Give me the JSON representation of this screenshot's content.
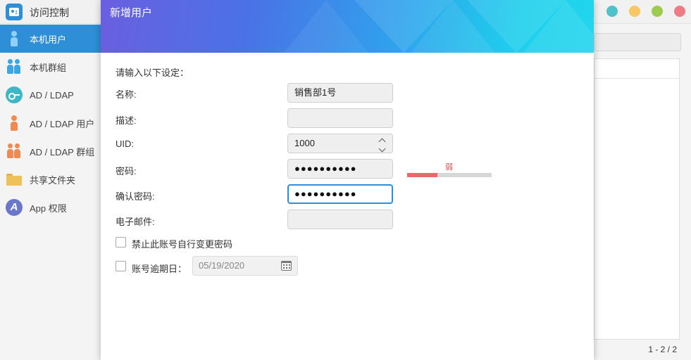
{
  "app": {
    "title": "访问控制",
    "window_controls": [
      {
        "name": "info-dot",
        "color": "#4fc1c8"
      },
      {
        "name": "minimize-dot",
        "color": "#f6c762"
      },
      {
        "name": "maximize-dot",
        "color": "#9ccb4f"
      },
      {
        "name": "close-dot",
        "color": "#ee7c86"
      }
    ]
  },
  "sidebar": {
    "items": [
      {
        "label": "本机用户",
        "icon": "user-icon",
        "active": true
      },
      {
        "label": "本机群組",
        "icon": "group-icon",
        "active": false
      },
      {
        "label": "AD / LDAP",
        "icon": "key-icon",
        "active": false
      },
      {
        "label": "AD / LDAP 用户",
        "icon": "user-icon",
        "active": false
      },
      {
        "label": "AD / LDAP 群组",
        "icon": "group-icon",
        "active": false
      },
      {
        "label": "共享文件夹",
        "icon": "folder-icon",
        "active": false
      },
      {
        "label": "App 权限",
        "icon": "app-icon",
        "active": false
      }
    ]
  },
  "main": {
    "pager": "1 - 2 / 2"
  },
  "dialog": {
    "title": "新增用户",
    "instruction": "请输入以下设定：",
    "fields": {
      "name": {
        "label": "名称:",
        "value": "销售部1号"
      },
      "description": {
        "label": "描述:",
        "value": ""
      },
      "uid": {
        "label": "UID:",
        "value": "1000"
      },
      "password": {
        "label": "密码:",
        "value": "●●●●●●●●●●"
      },
      "confirm_password": {
        "label": "确认密码:",
        "value": "●●●●●●●●●●"
      },
      "email": {
        "label": "电子邮件:",
        "value": ""
      }
    },
    "password_strength": {
      "label": "弱",
      "level": 0.36,
      "color": "#e96868"
    },
    "options": {
      "disallow_password_change": {
        "label": "禁止此账号自行变更密码",
        "checked": false
      },
      "account_expiry": {
        "label": "账号逾期日：",
        "checked": false,
        "date": "05/19/2020"
      }
    }
  },
  "colors": {
    "accent": "#2e8fd6",
    "header_gradient_start": "#6a5fe0",
    "header_gradient_end": "#22d6ee"
  }
}
